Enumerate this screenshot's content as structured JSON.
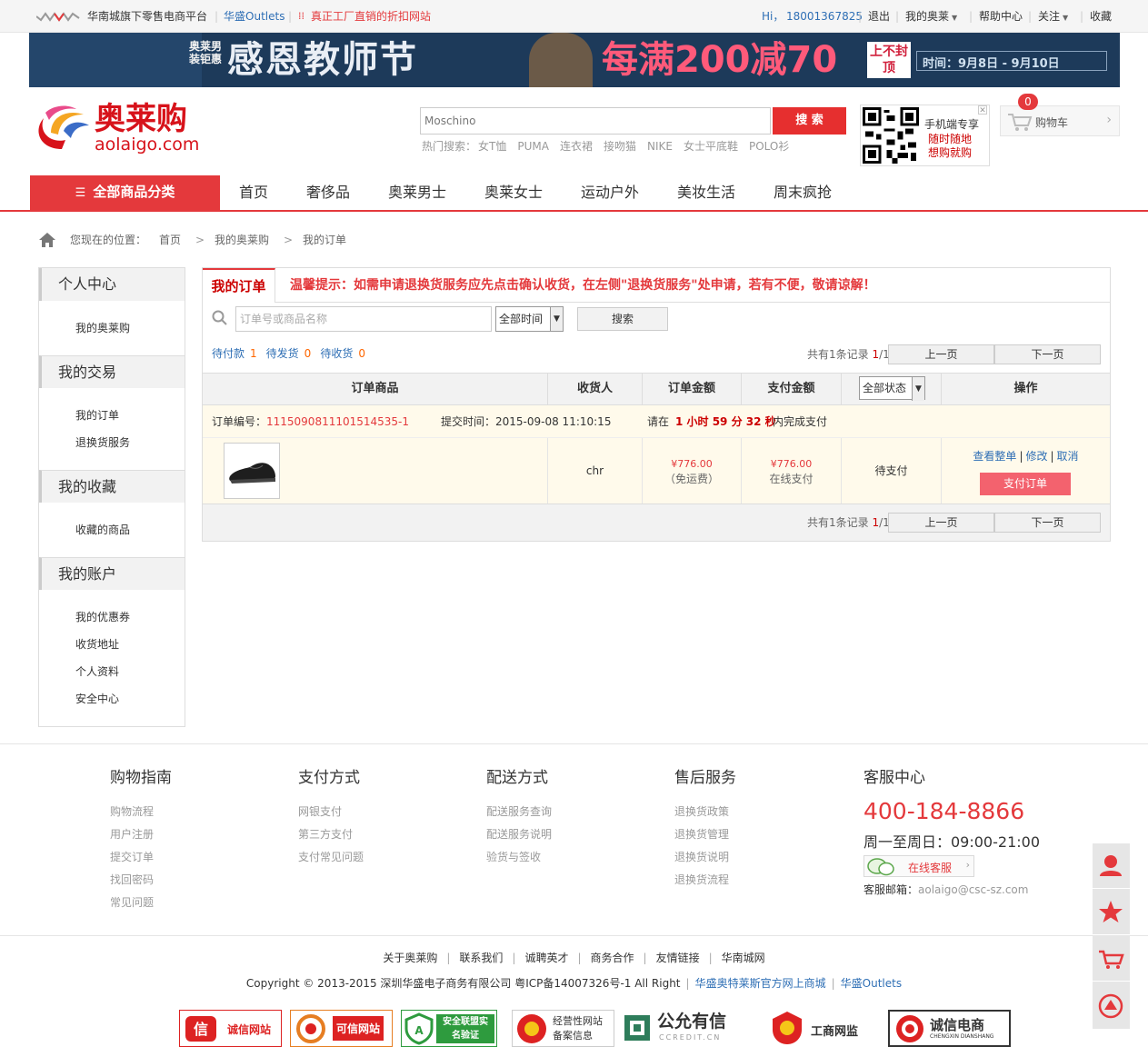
{
  "topbar": {
    "platform": "华南城旗下零售电商平台",
    "outlets_prefix": "华盛",
    "outlets": "Outlets",
    "slogan": "真正工厂直销的折扣网站",
    "greeting": "Hi，",
    "phone": "18001367825",
    "logout": "退出",
    "my_aolai": "我的奥莱",
    "help": "帮助中心",
    "follow": "关注",
    "favorite": "收藏"
  },
  "banner": {
    "small": "奥莱男装钜惠",
    "main": "感恩教师节",
    "offer": "每满200减70",
    "tag": "上不封顶",
    "time": "时间：9月8日 - 9月10日"
  },
  "header": {
    "logo_cn": "奥莱购",
    "logo_en": "aolaigo.com",
    "search_value": "Moschino",
    "search_button": "搜 索",
    "hot_label": "热门搜索：",
    "hot_words": [
      "女T恤",
      "PUMA",
      "连衣裙",
      "接吻猫",
      "NIKE",
      "女士平底鞋",
      "POLO衫"
    ],
    "qr_line1": "手机端专享",
    "qr_line2": "随时随地",
    "qr_line3": "想购就购",
    "cart_count": "0",
    "cart_label": "购物车"
  },
  "nav": {
    "all_categories": "全部商品分类",
    "items": [
      "首页",
      "奢侈品",
      "奥莱男士",
      "奥莱女士",
      "运动户外",
      "美妆生活",
      "周末疯抢"
    ]
  },
  "breadcrumb": {
    "label": "您现在的位置：",
    "items": [
      "首页",
      "我的奥莱购",
      "我的订单"
    ],
    "sep": ">"
  },
  "sidebar": {
    "groups": [
      {
        "title": "个人中心",
        "items": [
          "我的奥莱购"
        ]
      },
      {
        "title": "我的交易",
        "items": [
          "我的订单",
          "退换货服务"
        ]
      },
      {
        "title": "我的收藏",
        "items": [
          "收藏的商品"
        ]
      },
      {
        "title": "我的账户",
        "items": [
          "我的优惠券",
          "收货地址",
          "个人资料",
          "安全中心"
        ]
      }
    ]
  },
  "orders": {
    "tab": "我的订单",
    "tip": "温馨提示：如需申请退换货服务应先点击确认收货，在左侧\"退换货服务\"处申请，若有不便，敬请谅解！",
    "search_placeholder": "订单号或商品名称",
    "time_filter": "全部时间",
    "search_button": "搜索",
    "filters": [
      {
        "label": "待付款",
        "count": "1"
      },
      {
        "label": "待发货",
        "count": "0"
      },
      {
        "label": "待收货",
        "count": "0"
      }
    ],
    "pager_text_prefix": "共有1条记录",
    "pager_page": "1",
    "pager_total": "/1",
    "prev": "上一页",
    "next": "下一页",
    "columns": [
      "订单商品",
      "收货人",
      "订单金额",
      "支付金额",
      "全部状态",
      "操作"
    ],
    "order": {
      "no_label": "订单编号：",
      "no": "1115090811101514535-1",
      "time_label": "提交时间：",
      "time": "2015-09-08 11:10:15",
      "countdown_prefix": "请在",
      "countdown": "1 小时 59 分 32 秒",
      "countdown_suffix": "内完成支付",
      "receiver": "chr",
      "order_amount": "¥776.00",
      "shipping_note": "（免运费）",
      "pay_amount": "¥776.00",
      "pay_method": "在线支付",
      "status": "待支付",
      "actions": [
        "查看整单",
        "修改",
        "取消"
      ],
      "pay_button": "支付订单"
    }
  },
  "footer": {
    "columns": [
      {
        "title": "购物指南",
        "links": [
          "购物流程",
          "用户注册",
          "提交订单",
          "找回密码",
          "常见问题"
        ]
      },
      {
        "title": "支付方式",
        "links": [
          "网银支付",
          "第三方支付",
          "支付常见问题"
        ]
      },
      {
        "title": "配送方式",
        "links": [
          "配送服务查询",
          "配送服务说明",
          "验货与签收"
        ]
      },
      {
        "title": "售后服务",
        "links": [
          "退换货政策",
          "退换货管理",
          "退换货说明",
          "退换货流程"
        ]
      }
    ],
    "service_title": "客服中心",
    "hotline": "400-184-8866",
    "hours": "周一至周日：09:00-21:00",
    "online": "在线客服",
    "mail_label": "客服邮箱：",
    "mail": "aolaigo@csc-sz.com"
  },
  "bottom": {
    "links": [
      "关于奥莱购",
      "联系我们",
      "诚聘英才",
      "商务合作",
      "友情链接",
      "华南城网"
    ],
    "copyright": "Copyright © 2013-2015 深圳华盛电子商务有限公司 粤ICP备14007326号-1 All Right",
    "link1": "华盛奥特莱斯官方网上商城",
    "link2_prefix": "华盛",
    "link2": "Outlets",
    "badges": [
      "诚信网站",
      "可信网站",
      "安全联盟实名验证",
      "经营性网站备案信息",
      "公允有信",
      "CCREDIT.CN",
      "工商网监",
      "诚信电商",
      "CHENGXIN DIANSHANG"
    ]
  },
  "colors": {
    "brand_red": "#e4393c",
    "link_blue": "#2f6fb5",
    "pay_button": "#f3626e"
  }
}
